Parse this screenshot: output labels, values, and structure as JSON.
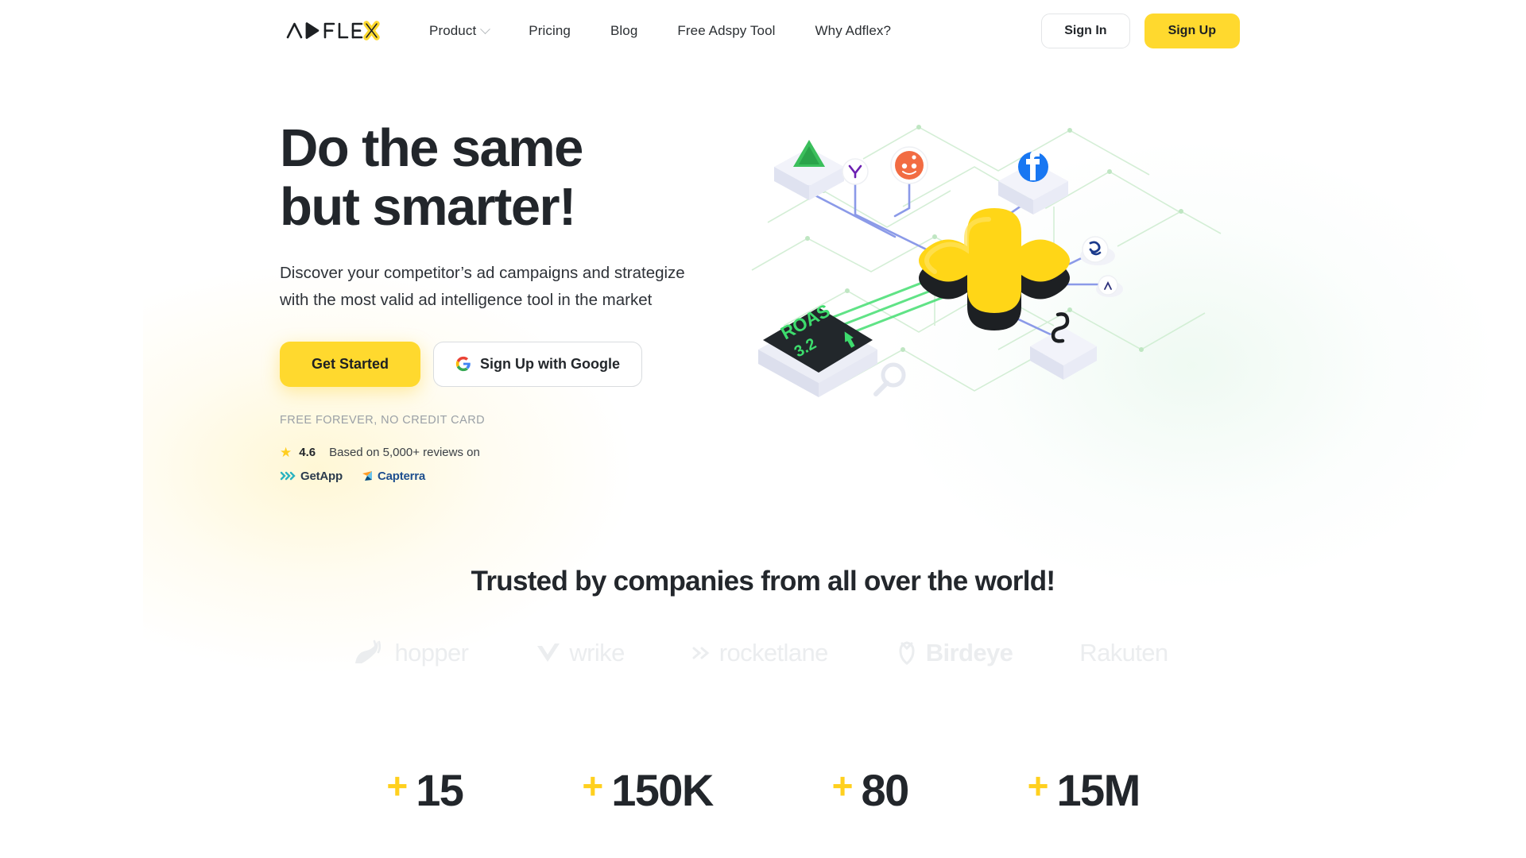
{
  "brand": {
    "name": "ADFLEX",
    "mark_color": "#FFD92E",
    "text_color": "#1d2023"
  },
  "theme": {
    "accent_yellow": "#FFD92E",
    "ink": "#22262b",
    "muted": "#9aa0a6"
  },
  "nav": {
    "items": [
      {
        "label": "Product",
        "has_dropdown": true
      },
      {
        "label": "Pricing",
        "has_dropdown": false
      },
      {
        "label": "Blog",
        "has_dropdown": false
      },
      {
        "label": "Free Adspy Tool",
        "has_dropdown": false
      },
      {
        "label": "Why Adflex?",
        "has_dropdown": false
      }
    ],
    "sign_in": "Sign In",
    "sign_up": "Sign Up"
  },
  "hero": {
    "title_line_1": "Do the same",
    "title_line_2": "but smarter!",
    "subtitle": "Discover your competitor’s ad campaigns and strategize with the most valid ad intelligence tool in the market",
    "cta_primary": "Get Started",
    "cta_google": "Sign Up with Google",
    "google_icon": "google-g-icon",
    "free_note": "FREE FOREVER, NO CREDIT CARD",
    "rating": {
      "star_icon": "star-icon",
      "score": "4.6",
      "text": "Based on 5,000+ reviews on",
      "sources": [
        {
          "name": "GetApp",
          "icon": "getapp-chevrons-icon",
          "color": "#2b3b4d"
        },
        {
          "name": "Capterra",
          "icon": "capterra-arrow-icon",
          "color": "#1e4f8f"
        }
      ]
    },
    "illustration": {
      "name": "isometric-adflex-network-illustration",
      "center_shape": "yellow-plus-cross",
      "roas_tile": {
        "label": "ROAS",
        "value": "3.2",
        "trend_icon": "arrow-up-icon",
        "text_color": "#3ddc6d"
      },
      "nodes": [
        "adroll-green-triangle-icon",
        "yahoo-purple-icon",
        "reddit-orange-icon",
        "facebook-blue-icon",
        "bing-badge-icon",
        "snapchat-icon",
        "tiktok-note-icon",
        "magnifier-icon"
      ]
    }
  },
  "trusted": {
    "title": "Trusted by companies from all over the world!",
    "logos": [
      {
        "name": "hopper",
        "icon": "hopper-bunny-icon"
      },
      {
        "name": "wrike",
        "icon": "wrike-check-icon"
      },
      {
        "name": "rocketlane",
        "icon": "rocketlane-chevrons-icon"
      },
      {
        "name": "Birdeye",
        "icon": "birdeye-bird-icon"
      },
      {
        "name": "Rakuten",
        "icon": "rakuten-underline-icon"
      }
    ]
  },
  "stats": [
    {
      "plus": "+",
      "value": "15"
    },
    {
      "plus": "+",
      "value": "150K"
    },
    {
      "plus": "+",
      "value": "80"
    },
    {
      "plus": "+",
      "value": "15M"
    }
  ]
}
